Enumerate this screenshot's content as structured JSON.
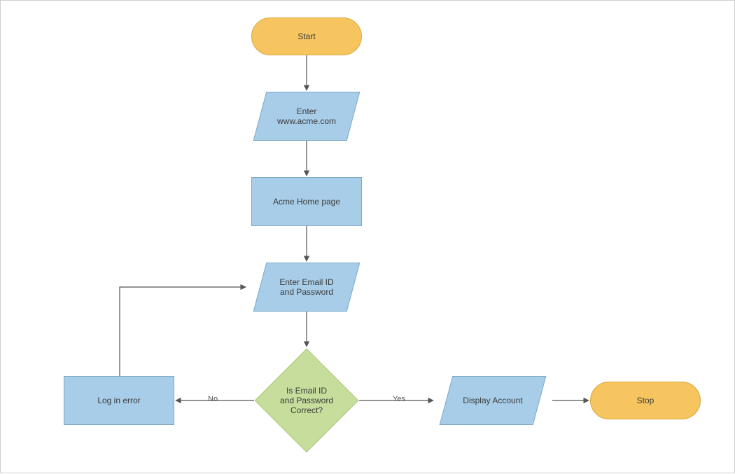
{
  "colors": {
    "terminator_fill": "#f6c560",
    "terminator_stroke": "#d9a83e",
    "process_fill": "#a8cde8",
    "process_stroke": "#7aa9c9",
    "decision_fill": "#c6dd9b",
    "decision_stroke": "#9cbb6a",
    "io_fill": "#a8cde8",
    "io_stroke": "#7aa9c9",
    "connector": "#555555",
    "text": "#3b3b3b"
  },
  "nodes": {
    "start": "Start",
    "enter_url": "Enter\nwww.acme.com",
    "home_page": "Acme Home page",
    "enter_creds": "Enter Email ID\nand Password",
    "decision": "Is Email ID\nand Password\nCorrect?",
    "login_error": "Log in error",
    "display_account": "Display Account",
    "stop": "Stop"
  },
  "edge_labels": {
    "yes": "Yes",
    "no": "No"
  }
}
